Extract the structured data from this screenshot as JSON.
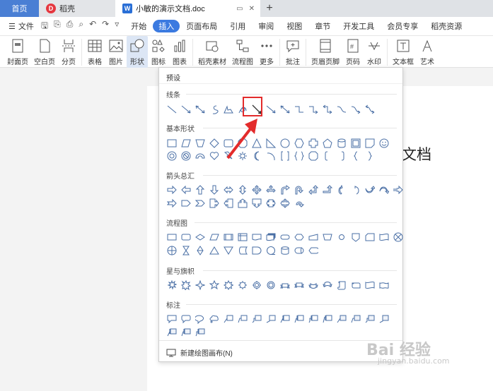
{
  "tabs": {
    "home": "首页",
    "daoke": "稻壳",
    "doc": "小敏的演示文档.doc",
    "plus": "+"
  },
  "menubar": {
    "file": "文件",
    "items": [
      "开始",
      "插入",
      "页面布局",
      "引用",
      "审阅",
      "视图",
      "章节",
      "开发工具",
      "会员专享",
      "稻壳资源"
    ]
  },
  "ribbon": {
    "items": [
      "封面页",
      "空白页",
      "分页",
      "表格",
      "图片",
      "形状",
      "图标",
      "图表",
      "稻壳素材",
      "流程图",
      "更多",
      "批注",
      "页眉页脚",
      "页码",
      "水印",
      "文本框",
      "艺术"
    ]
  },
  "document": {
    "visible_text": "文档"
  },
  "shapes_panel": {
    "header": "预设",
    "categories": [
      "线条",
      "基本形状",
      "箭头总汇",
      "流程图",
      "星与旗帜",
      "标注"
    ],
    "new_canvas": "新建绘图画布(N)"
  },
  "watermark": {
    "main": "Bai 经验",
    "sub": "jingyan.baidu.com"
  },
  "colors": {
    "accent": "#3b7ae0",
    "home_tab": "#4a7fd4",
    "highlight": "#e32b2b",
    "shape_stroke": "#4a6fa5"
  }
}
